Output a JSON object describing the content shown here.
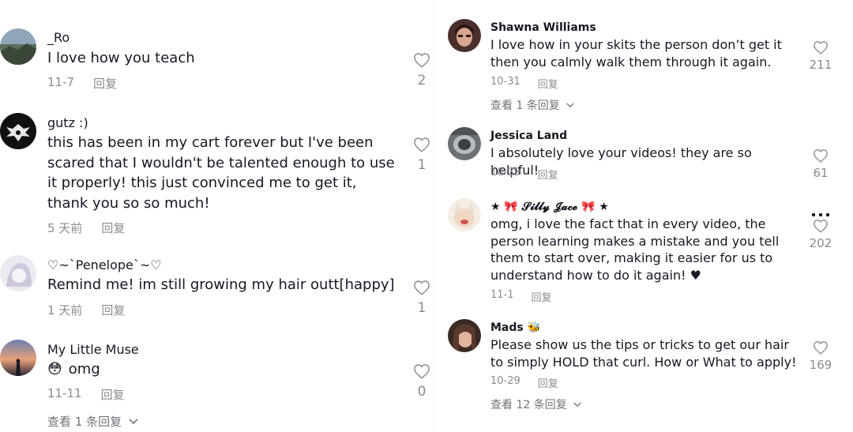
{
  "left": [
    {
      "username": "_Ro",
      "text": "I love how you teach",
      "date": "11-7",
      "reply": "回复",
      "likes": "2"
    },
    {
      "username": "gutz :)",
      "text": "this has been in my cart forever but I've been scared that I wouldn't be talented enough to use it properly! this just convinced me to get it, thank you so so much!",
      "date": "5 天前",
      "reply": "回复",
      "likes": "1"
    },
    {
      "username": "♡~`Penelope`~♡",
      "text": "Remind me! im still growing my hair outt[happy]",
      "date": "1 天前",
      "reply": "回复",
      "likes": "1"
    },
    {
      "username": "My Little Muse",
      "emoji": "😳",
      "text": "omg",
      "date": "11-11",
      "reply": "回复",
      "likes": "0",
      "more_replies": "查看 1 条回复"
    }
  ],
  "right": [
    {
      "username": "Shawna Williams",
      "text": "I love how in your skits the person don’t get it then you calmly walk them through it again.",
      "date": "10-31",
      "reply": "回复",
      "likes": "211",
      "more_replies": "查看 1 条回复"
    },
    {
      "username": "Jessica Land",
      "text": "I absolutely love your videos! they are so helpful!",
      "date": "10-29",
      "reply": "回复",
      "likes": "61"
    },
    {
      "username": "★ 🎀 𝓢𝓲𝓵𝓵𝔂 𝓙𝓪𝓬𝓮 🎀 ★",
      "text": "omg, i love the fact that in every video, the person learning makes a mistake and you tell them to start over, making it easier for us to understand how to do it again! ♥",
      "date": "11-1",
      "reply": "回复",
      "likes": "202"
    },
    {
      "username": "Mads 🐝",
      "text": "Please show us the tips or tricks to get our hair to simply HOLD that curl. How or What to apply!",
      "date": "10-29",
      "reply": "回复",
      "likes": "169",
      "more_replies": "查看 12 条回复"
    }
  ],
  "icons": {
    "like": "heart-outline-icon",
    "expand": "chevron-down-icon",
    "more": "more-dots-icon"
  },
  "colors": {
    "text": "#161823",
    "secondary": "#8a8b91",
    "divider": "#f1f1f2"
  }
}
